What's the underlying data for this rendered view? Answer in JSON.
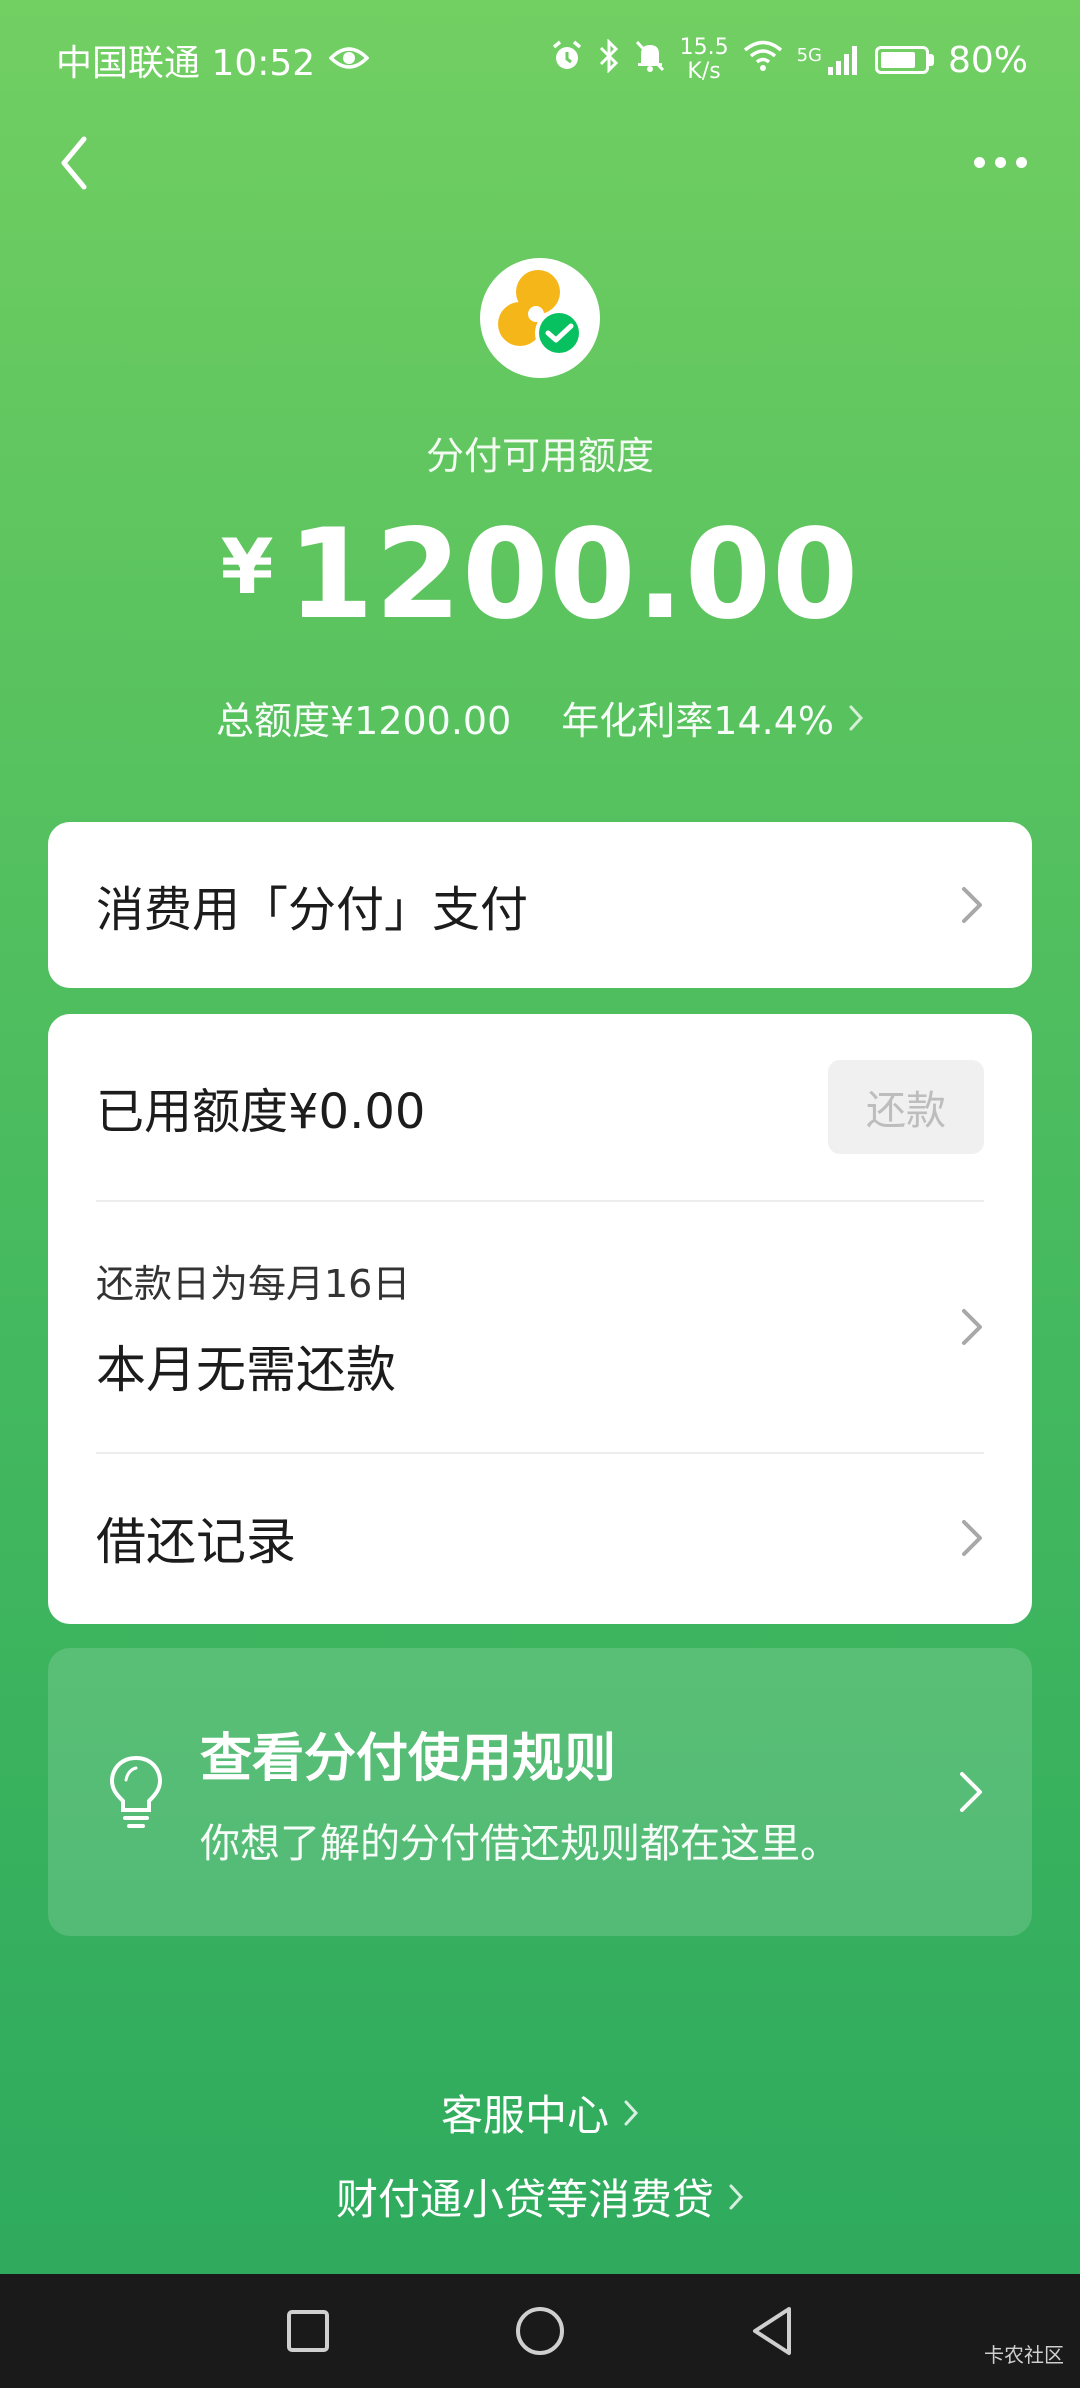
{
  "status_bar": {
    "carrier_time": "中国联通 10:52",
    "net_speed_value": "15.5",
    "net_speed_unit": "K/s",
    "network_type": "5G",
    "battery_percent": "80%",
    "battery_level": 0.8,
    "icons": [
      "eye-icon",
      "alarm-icon",
      "bluetooth-icon",
      "mute-bell-icon",
      "wifi-icon",
      "signal-icon",
      "battery-icon"
    ]
  },
  "header": {
    "back_icon": "chevron-left-icon",
    "more_icon": "more-dots-icon"
  },
  "hero": {
    "label": "分付可用额度",
    "currency": "¥",
    "amount": "1200.00",
    "total_limit": "总额度¥1200.00",
    "annual_rate": "年化利率14.4%"
  },
  "pay_card": {
    "label": "消费用「分付」支付"
  },
  "main_card": {
    "used_label": "已用额度¥0.00",
    "repay_button": "还款",
    "due_day": "还款日为每月16日",
    "due_status": "本月无需还款",
    "records": "借还记录"
  },
  "rules_card": {
    "title": "查看分付使用规则",
    "desc": "你想了解的分付借还规则都在这里。"
  },
  "footer_links": {
    "service": "客服中心",
    "loan": "财付通小贷等消费贷"
  },
  "system_nav": {
    "icons": [
      "recent-apps-icon",
      "home-icon",
      "back-triangle-icon"
    ]
  },
  "watermark": "卡农社区",
  "colors": {
    "gradient_top": "#72cf62",
    "gradient_bottom": "#2ea95d",
    "logo_yellow": "#f5b61a",
    "logo_green": "#07c160"
  }
}
